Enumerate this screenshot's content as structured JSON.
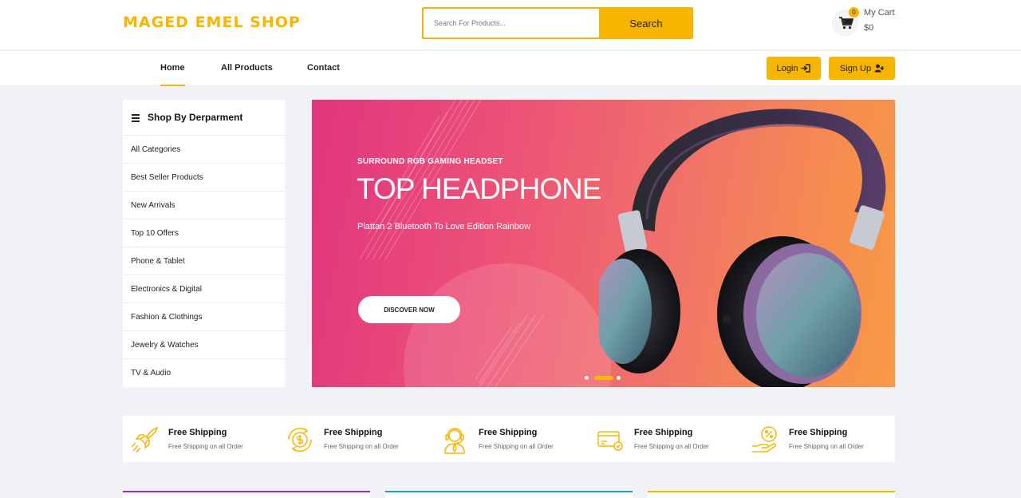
{
  "header": {
    "logo": "MAGED EMEL SHOP",
    "search_placeholder": "Search For Products...",
    "search_button": "Search",
    "cart_count": "0",
    "cart_label": "My Cart",
    "cart_total": "$0"
  },
  "nav": {
    "links": [
      "Home",
      "All Products",
      "Contact"
    ],
    "active": "Home",
    "login": "Login",
    "signup": "Sign Up"
  },
  "sidebar": {
    "title": "Shop By Derparment",
    "items": [
      "All Categories",
      "Best Seller Products",
      "New Arrivals",
      "Top 10 Offers",
      "Phone & Tablet",
      "Electronics & Digital",
      "Fashion & Clothings",
      "Jewelry & Watches",
      "TV & Audio"
    ]
  },
  "banner": {
    "kicker": "SURROUND RGB GAMING HEADSET",
    "title": "TOP HEADPHONE",
    "subtitle": "Plattan 2 Bluetooth To Love Edition Rainbow",
    "button": "DISCOVER NOW",
    "slide_count": 3,
    "active_slide": 2
  },
  "features": [
    {
      "icon": "rocket-icon",
      "title": "Free Shipping",
      "subtitle": "Free Shipping on all Order"
    },
    {
      "icon": "money-back-icon",
      "title": "Free Shipping",
      "subtitle": "Free Shipping on all Order"
    },
    {
      "icon": "support-agent-icon",
      "title": "Free Shipping",
      "subtitle": "Free Shipping on all Order"
    },
    {
      "icon": "secure-card-icon",
      "title": "Free Shipping",
      "subtitle": "Free Shipping on all Order"
    },
    {
      "icon": "discount-hand-icon",
      "title": "Free Shipping",
      "subtitle": "Free Shipping on all Order"
    }
  ],
  "colors": {
    "accent": "#f7b500",
    "strip_1": "#9b2fae",
    "strip_2": "#1b9eb0",
    "strip_3": "#f7b500"
  }
}
